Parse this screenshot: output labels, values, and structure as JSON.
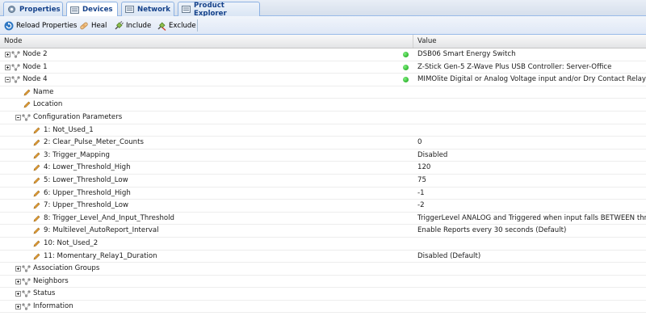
{
  "tabs": [
    {
      "label": "Properties",
      "icon": "gear-icon",
      "active": false
    },
    {
      "label": "Devices",
      "icon": "devices-icon",
      "active": true
    },
    {
      "label": "Network",
      "icon": "network-icon",
      "active": false
    },
    {
      "label": "Product Explorer",
      "icon": "product-explorer-icon",
      "active": false
    }
  ],
  "toolbar": {
    "reload_label": "Reload Properties",
    "heal_label": "Heal",
    "include_label": "Include",
    "exclude_label": "Exclude"
  },
  "grid": {
    "header": {
      "node": "Node",
      "value": "Value"
    },
    "status_color": "#22b422",
    "rows": {
      "node2": {
        "label": "Node 2",
        "value": "DSB06 Smart Energy Switch"
      },
      "node1": {
        "label": "Node 1",
        "value": "Z-Stick Gen-5 Z-Wave Plus USB Controller: Server-Office"
      },
      "node4": {
        "label": "Node 4",
        "value": "MIMOlite Digital or Analog Voltage input and/or Dry Contact Relay"
      },
      "name": {
        "label": "Name",
        "value": ""
      },
      "location": {
        "label": "Location",
        "value": ""
      },
      "config": {
        "label": "Configuration Parameters",
        "value": ""
      },
      "p1": {
        "label": "1: Not_Used_1",
        "value": ""
      },
      "p2": {
        "label": "2: Clear_Pulse_Meter_Counts",
        "value": "0"
      },
      "p3": {
        "label": "3: Trigger_Mapping",
        "value": "Disabled"
      },
      "p4": {
        "label": "4: Lower_Threshold_High",
        "value": "120"
      },
      "p5": {
        "label": "5: Lower_Threshold_Low",
        "value": "75"
      },
      "p6": {
        "label": "6: Upper_Threshold_High",
        "value": "-1"
      },
      "p7": {
        "label": "7: Upper_Threshold_Low",
        "value": "-2"
      },
      "p8": {
        "label": "8: Trigger_Level_And_Input_Threshold",
        "value": "TriggerLevel ANALOG and Triggered when input falls BETWEEN thresholds"
      },
      "p9": {
        "label": "9: Multilevel_AutoReport_Interval",
        "value": "Enable Reports every 30 seconds (Default)"
      },
      "p10": {
        "label": "10: Not_Used_2",
        "value": ""
      },
      "p11": {
        "label": "11: Momentary_Relay1_Duration",
        "value": "Disabled (Default)"
      },
      "assoc": {
        "label": "Association Groups",
        "value": ""
      },
      "neighbors": {
        "label": "Neighbors",
        "value": ""
      },
      "status": {
        "label": "Status",
        "value": ""
      },
      "information": {
        "label": "Information",
        "value": ""
      }
    }
  }
}
